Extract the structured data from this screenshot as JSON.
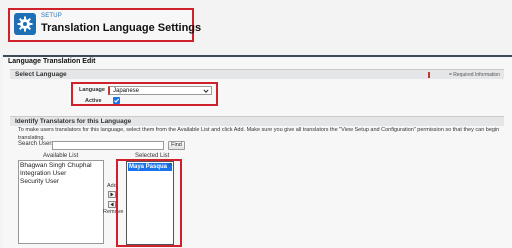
{
  "header": {
    "setup_label": "SETUP",
    "title": "Translation Language Settings",
    "icon": "gear-icon",
    "accent": "#1f6fb5",
    "highlight": "#d0202b"
  },
  "edit": {
    "title": "Language Translation Edit"
  },
  "select_language": {
    "section_title": "Select Language",
    "required_info": "= Required Information",
    "language_label": "Language",
    "language_value": "Japanese",
    "active_label": "Active",
    "active_checked": true
  },
  "translators": {
    "section_title": "Identify Translators for this Language",
    "intro": "To make users translators for this language, select them from the Available List and click Add. Make sure you give all translators the \"View Setup and Configuration\" permission so that they can begin translating.",
    "search_label": "Search Users",
    "search_value": "",
    "find_label": "Find",
    "available_heading": "Available List",
    "available_items": [
      "Bhagwan Singh Chuphal",
      "Integration User",
      "Security User"
    ],
    "add_label": "Add",
    "remove_label": "Remove",
    "selected_heading": "Selected List",
    "selected_items": [
      "Maya Pasqua"
    ]
  }
}
